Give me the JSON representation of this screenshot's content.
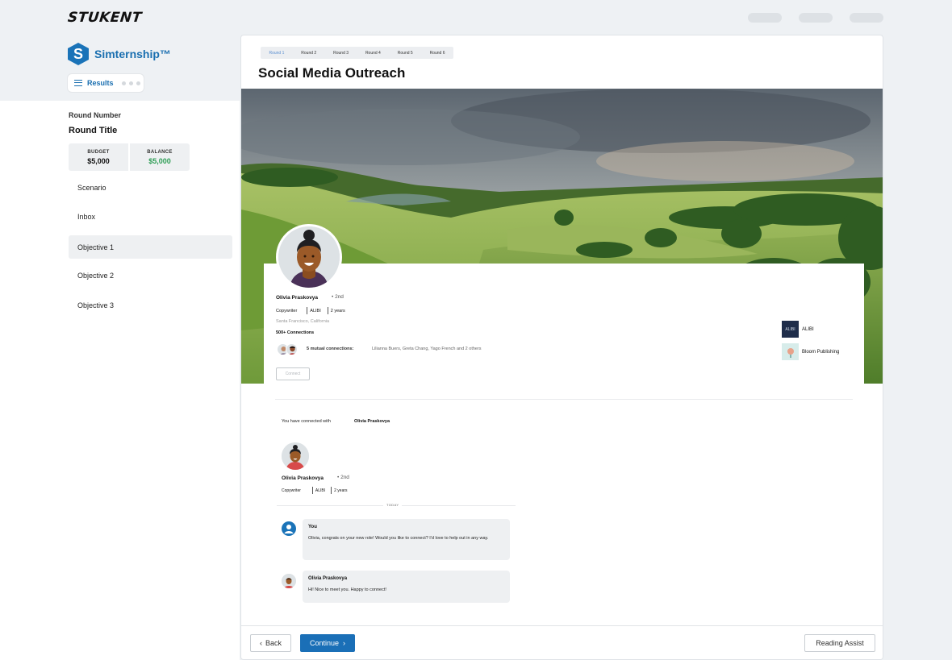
{
  "header": {
    "logo": "STUKENT"
  },
  "sidebar": {
    "brand_letter": "S",
    "brand_name": "Simternship™",
    "results_label": "Results",
    "round_number": "Round Number",
    "round_title": "Round Title",
    "budget": {
      "budget_label": "BUDGET",
      "budget_value": "$5,000",
      "balance_label": "BALANCE",
      "balance_value": "$5,000"
    },
    "items": [
      {
        "label": "Scenario"
      },
      {
        "label": "Inbox"
      },
      {
        "label": "Objective 1"
      },
      {
        "label": "Objective 2"
      },
      {
        "label": "Objective 3"
      }
    ]
  },
  "main": {
    "rounds": [
      "Round 1",
      "Round 2",
      "Round 3",
      "Round 4",
      "Round 5",
      "Round 6"
    ],
    "title": "Social Media Outreach",
    "profile": {
      "name": "Olivia Praskovya",
      "degree": "• 2nd",
      "role": "Copywriter",
      "company": "ALIBI",
      "tenure": "2 years",
      "location": "Santa Francisco, California",
      "connections": "500+ Connections",
      "mutual": "5 mutual connections:",
      "mutual_names": "Lilianna Buers, Greta Chang, Yago French and 2 others",
      "connect_label": "Connect",
      "companies": [
        {
          "logo": "ALIBI",
          "name": "ALIBI"
        },
        {
          "logo": "",
          "name": "Bloom Publishing"
        }
      ]
    },
    "conversation": {
      "connected_text": "You have connected with",
      "connected_name": "Olivia Praskovya",
      "name": "Olivia Praskovya",
      "degree": "• 2nd",
      "role": "Copywriter",
      "company": "ALIBI",
      "tenure": "2 years",
      "today": "TODAY",
      "messages": [
        {
          "sender": "You",
          "text": "Olivia, congrats on your new role! Would you like to connect? I'd love to help out in any way."
        },
        {
          "sender": "Olivia Praskovya",
          "text": "Hi! Nice to meet you. Happy to connect!"
        }
      ]
    }
  },
  "footer": {
    "back": "Back",
    "continue": "Continue",
    "reading_assist": "Reading Assist"
  },
  "colors": {
    "accent": "#1a6fb7",
    "balance_green": "#2e9d55",
    "background": "#eef1f4"
  }
}
